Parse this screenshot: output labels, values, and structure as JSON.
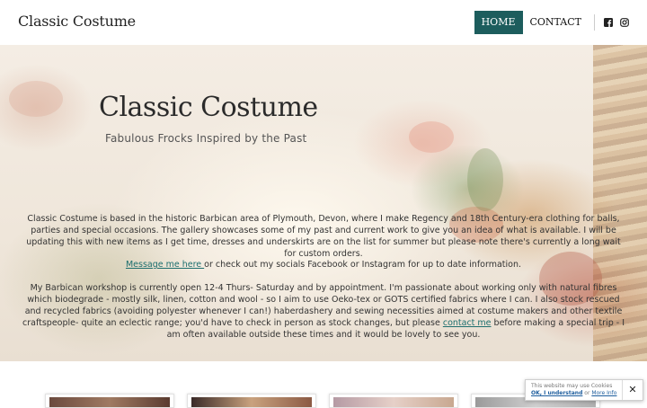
{
  "header": {
    "brand": "Classic Costume",
    "nav": [
      {
        "label": "HOME",
        "active": true
      },
      {
        "label": "CONTACT",
        "active": false
      }
    ],
    "social": [
      "facebook-icon",
      "instagram-icon"
    ],
    "accent_color": "#1d5d5d"
  },
  "hero": {
    "title": "Classic Costume",
    "subtitle": "Fabulous Frocks Inspired by the Past",
    "paragraph1": "Classic Costume is based in the historic Barbican area of Plymouth, Devon, where I make Regency and 18th Century-era clothing for balls, parties and special occasions.   The gallery showcases some of my past and current work to give you an idea of what is available.  I will be updating this with new items as I get time, dresses and underskirts are on the list for summer but please note there's currently a long wait for custom orders.",
    "message_link": "Message me here ",
    "message_rest": "or check out my socials Facebook or Instagram for up to date information.",
    "paragraph3_start": "My Barbican workshop is currently open 12-4 Thurs- Saturday and by appointment.  I'm passionate about working only with natural fibres which biodegrade - mostly silk, linen, cotton and wool - so I aim to use Oeko-tex or GOTS certified fabrics where I can. I also stock rescued and recycled fabrics (avoiding polyester whenever I can!)  haberdashery and sewing necessities aimed at costume makers and other textile craftspeople- quite an eclectic range; you'd have to check in person as stock changes, but please ",
    "contact_link": "contact me",
    "paragraph3_end": "  before making a special trip - I am often available outside these times and it would be lovely to see you."
  },
  "cookie": {
    "line1": "This website may use Cookies",
    "ok_label": "OK, I understand",
    "or_text": " or ",
    "more_label": "More Info",
    "close_label": "✕"
  }
}
